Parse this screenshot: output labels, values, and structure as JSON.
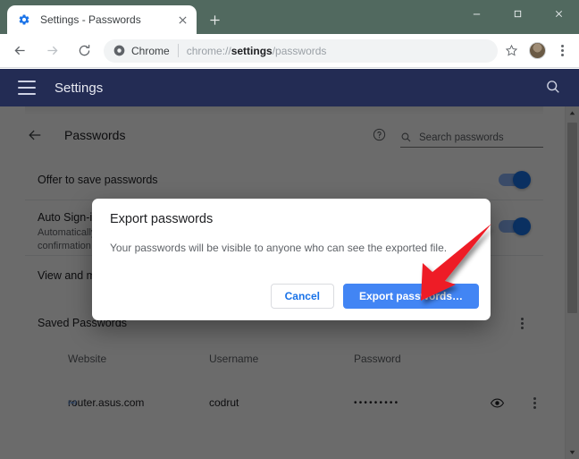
{
  "window": {
    "controls": {
      "minimize": "–",
      "maximize": "□",
      "close": "✕"
    }
  },
  "tabstrip": {
    "tab_title": "Settings - Passwords",
    "tab_favicon": "gear-icon",
    "close_label": "✕",
    "new_tab_label": "+"
  },
  "toolbar": {
    "back": "←",
    "forward": "→",
    "reload": "⟳",
    "chip_label": "Chrome",
    "url_prefix": "chrome://",
    "url_bold": "settings",
    "url_suffix": "/passwords",
    "url_full": "chrome://settings/passwords",
    "bookmark": "☆",
    "profile": "avatar",
    "menu": "kebab-icon"
  },
  "settings_header": {
    "menu_icon": "hamburger-icon",
    "title": "Settings",
    "search_icon": "search-icon"
  },
  "subheader": {
    "back_icon": "arrow-left-icon",
    "title": "Passwords",
    "help_icon": "help-icon",
    "search_placeholder": "Search passwords",
    "search_value": ""
  },
  "settings_rows": [
    {
      "label": "Offer to save passwords",
      "sub": "",
      "toggle_on": true
    },
    {
      "label": "Auto Sign-in",
      "sub": "Automatically sign in to websites using stored\nconfirmation every time.",
      "toggle_on": true
    },
    {
      "label": "View and manage saved passwords in your Google Account",
      "sub": "",
      "toggle_on": null
    }
  ],
  "saved_passwords": {
    "section_title": "Saved Passwords",
    "menu_icon": "kebab-icon",
    "columns": [
      "Website",
      "Username",
      "Password"
    ],
    "rows": [
      {
        "favicon": "wifi-icon",
        "website": "router.asus.com",
        "username": "codrut",
        "password_masked": "•••••••••",
        "show_icon": "eye-icon",
        "row_menu": "kebab-icon"
      }
    ]
  },
  "dialog": {
    "title": "Export passwords",
    "message": "Your passwords will be visible to anyone who can see the exported file.",
    "cancel_label": "Cancel",
    "confirm_label": "Export passwords…"
  },
  "annotation": {
    "type": "red-arrow",
    "points_to": "confirm-export-button",
    "color": "#ee1c25"
  },
  "scrollbar": {
    "up_arrow": "▲",
    "down_arrow": "▼"
  },
  "colors": {
    "titlebar": "#51695f",
    "settings_header": "#232c54",
    "primary_button": "#4285f4",
    "link_blue": "#1a73e8",
    "toggle_on": "#1a73e8",
    "annotation_red": "#ee1c25"
  }
}
